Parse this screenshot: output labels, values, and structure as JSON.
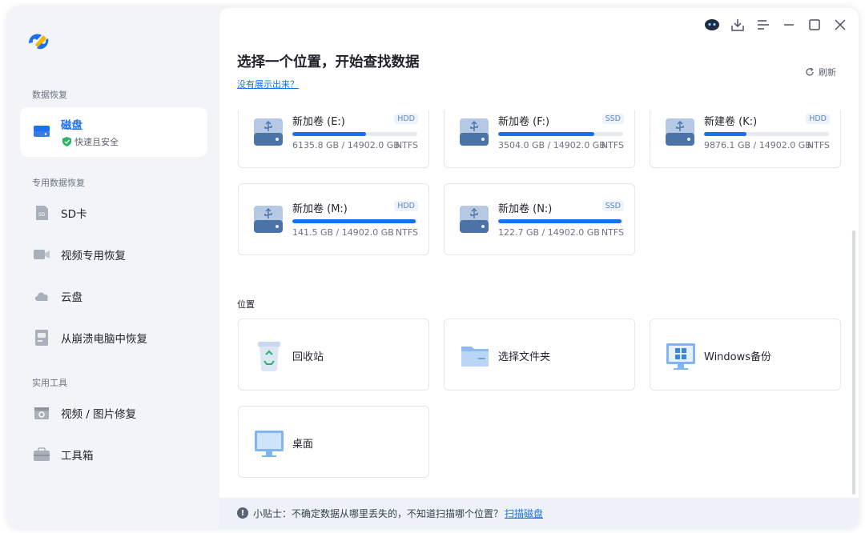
{
  "sidebar": {
    "sections": [
      {
        "title": "数据恢复"
      },
      {
        "title": "专用数据恢复"
      },
      {
        "title": "实用工具"
      }
    ],
    "active_item": {
      "label": "磁盘",
      "sub": "快速且安全",
      "icon": "disk-icon"
    },
    "items": [
      {
        "label": "SD卡",
        "icon": "sd-card-icon"
      },
      {
        "label": "视频专用恢复",
        "icon": "video-camera-icon"
      },
      {
        "label": "云盘",
        "icon": "cloud-icon"
      },
      {
        "label": "从崩溃电脑中恢复",
        "icon": "crashed-pc-icon"
      },
      {
        "label": "视频 / 图片修复",
        "icon": "repair-icon"
      },
      {
        "label": "工具箱",
        "icon": "toolbox-icon"
      }
    ]
  },
  "header": {
    "title": "选择一个位置，开始查找数据",
    "help_link": "没有展示出来？",
    "refresh": "刷新"
  },
  "drives": [
    {
      "name": "新加卷 (E:)",
      "type": "HDD",
      "used": "6135.8 GB",
      "total": "14902.0 GB",
      "fs": "NTFS",
      "fill": 0.59
    },
    {
      "name": "新加卷 (F:)",
      "type": "SSD",
      "used": "3504.0 GB",
      "total": "14902.0 GB",
      "fs": "NTFS",
      "fill": 0.77
    },
    {
      "name": "新建卷 (K:)",
      "type": "HDD",
      "used": "9876.1 GB",
      "total": "14902.0 GB",
      "fs": "NTFS",
      "fill": 0.34
    },
    {
      "name": "新加卷 (M:)",
      "type": "HDD",
      "used": "141.5 GB",
      "total": "14902.0 GB",
      "fs": "NTFS",
      "fill": 0.99
    },
    {
      "name": "新加卷 (N:)",
      "type": "SSD",
      "used": "122.7 GB",
      "total": "14902.0 GB",
      "fs": "NTFS",
      "fill": 0.99
    }
  ],
  "locations_title": "位置",
  "locations": [
    {
      "label": "回收站",
      "icon": "recycle-bin-icon"
    },
    {
      "label": "选择文件夹",
      "icon": "folder-icon"
    },
    {
      "label": "Windows备份",
      "icon": "windows-backup-icon"
    },
    {
      "label": "桌面",
      "icon": "desktop-icon"
    }
  ],
  "tip": {
    "text": "小贴士：不确定数据从哪里丢失的，不知道扫描哪个位置？",
    "link": "扫描磁盘"
  },
  "colors": {
    "accent": "#1a6ff2",
    "safe": "#2fb36a"
  }
}
